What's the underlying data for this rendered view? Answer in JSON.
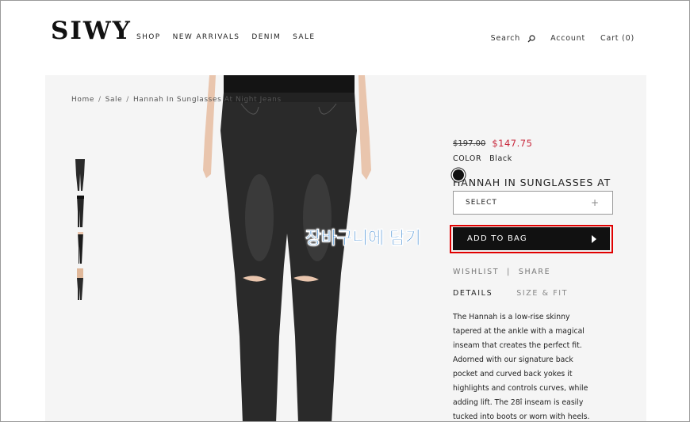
{
  "header": {
    "logo": "SIWY",
    "nav": [
      "SHOP",
      "NEW ARRIVALS",
      "DENIM",
      "SALE"
    ],
    "search_label": "Search",
    "account_label": "Account",
    "cart_label": "Cart (0)"
  },
  "breadcrumb": {
    "home": "Home",
    "sale": "Sale",
    "current": "Hannah In Sunglasses At Night Jeans"
  },
  "product": {
    "title": "HANNAH IN SUNGLASSES AT NIGHT JEANS",
    "old_price": "$197.00",
    "new_price": "$147.75",
    "color_label": "COLOR",
    "color_value": "Black",
    "swatch_color": "#111111",
    "size_select": "SELECT",
    "size_select_plus": "+",
    "add_to_bag": "ADD TO BAG",
    "wishlist": "WISHLIST",
    "share_sep": "|",
    "share": "SHARE",
    "tabs": [
      "DETAILS",
      "SIZE & FIT"
    ],
    "description": "The Hannah is a low-rise skinny tapered at the ankle with a magical inseam that creates the perfect fit. Adorned with our signature back pocket and curved back yokes it highlights and controls curves, while adding lift. The 28î inseam is easily tucked into boots or worn with heels."
  },
  "annotation": {
    "text": "장바구니에 담기",
    "color": "#1a73c9",
    "highlight_color": "#e00000"
  },
  "colors": {
    "panel_bg": "#f5f5f5",
    "sale_red": "#c8283c",
    "button_bg": "#111111"
  },
  "thumbnails": [
    "thumbnail-front",
    "thumbnail-side",
    "thumbnail-back",
    "thumbnail-styled"
  ]
}
